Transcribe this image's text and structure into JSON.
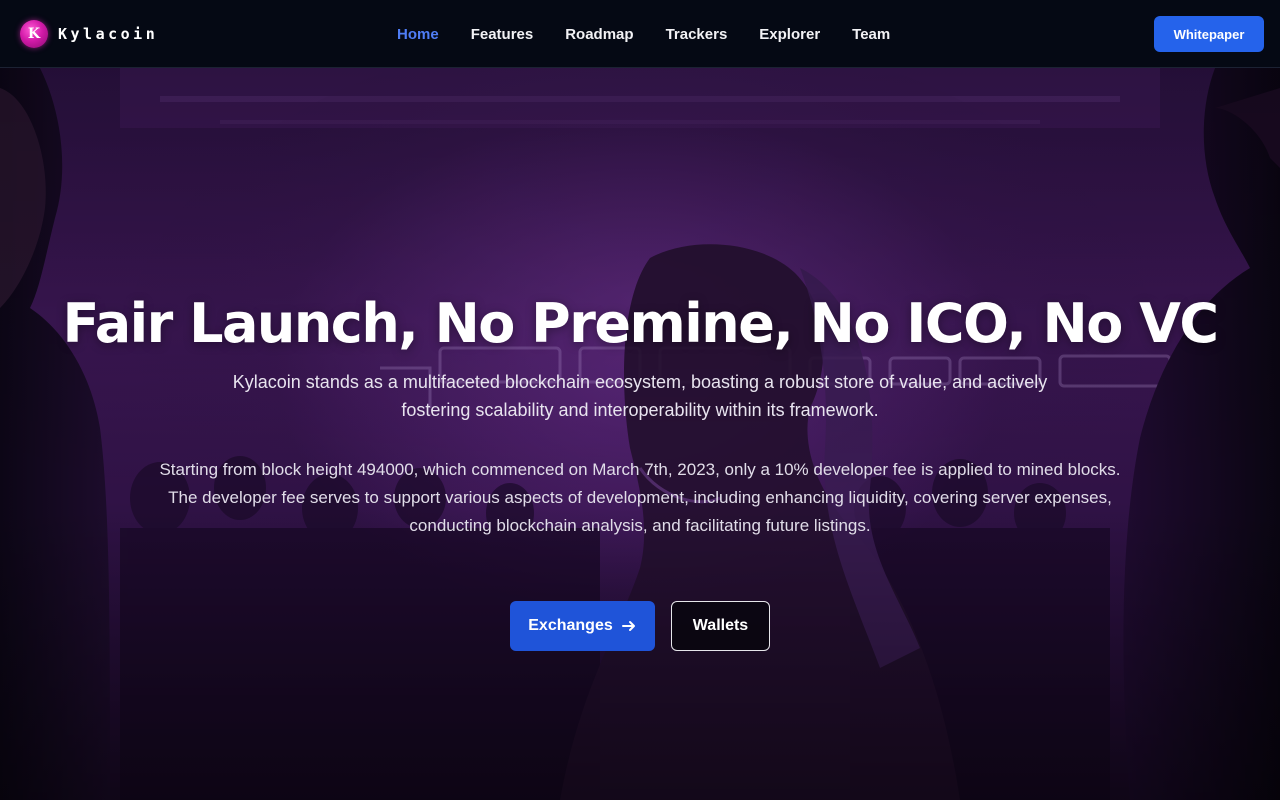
{
  "brand": {
    "logo_letter": "K",
    "name": "Kylacoin"
  },
  "nav": {
    "items": [
      {
        "label": "Home",
        "active": true
      },
      {
        "label": "Features",
        "active": false
      },
      {
        "label": "Roadmap",
        "active": false
      },
      {
        "label": "Trackers",
        "active": false
      },
      {
        "label": "Explorer",
        "active": false
      },
      {
        "label": "Team",
        "active": false
      }
    ],
    "cta_label": "Whitepaper"
  },
  "hero": {
    "title": "Fair Launch, No Premine, No ICO, No VC",
    "lead": "Kylacoin stands as a multifaceted blockchain ecosystem, boasting a robust store of value, and actively fostering scalability and interoperability within its framework.",
    "note_1": "Starting from block height 494000, which commenced on March 7th, 2023, only a 10% developer fee is applied to mined blocks.",
    "note_2": "The developer fee serves to support various aspects of development, including enhancing liquidity, covering server expenses, conducting blockchain analysis, and facilitating future listings.",
    "primary_button": "Exchanges",
    "primary_button_icon": "arrow-right-icon",
    "secondary_button": "Wallets",
    "background_image": "purple cyberpunk crowd with silhouettes"
  },
  "colors": {
    "accent": "#2563eb",
    "nav_active": "#4f7df5",
    "navbar_bg": "#050914",
    "hero_purple": "#3a1652",
    "logo_magenta": "#d21aa8"
  }
}
